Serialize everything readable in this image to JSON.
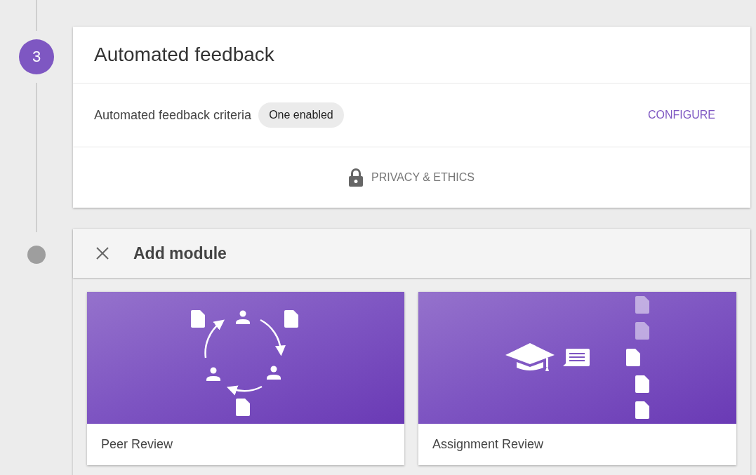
{
  "step": {
    "number": "3",
    "title": "Automated feedback"
  },
  "criteria": {
    "label": "Automated feedback criteria",
    "chip": "One enabled",
    "action": "CONFIGURE"
  },
  "privacy_link": "PRIVACY & ETHICS",
  "add_module": {
    "title": "Add module",
    "modules": [
      {
        "kind": "peer",
        "title": "Peer Review"
      },
      {
        "kind": "assignment",
        "title": "Assignment Review"
      }
    ]
  }
}
